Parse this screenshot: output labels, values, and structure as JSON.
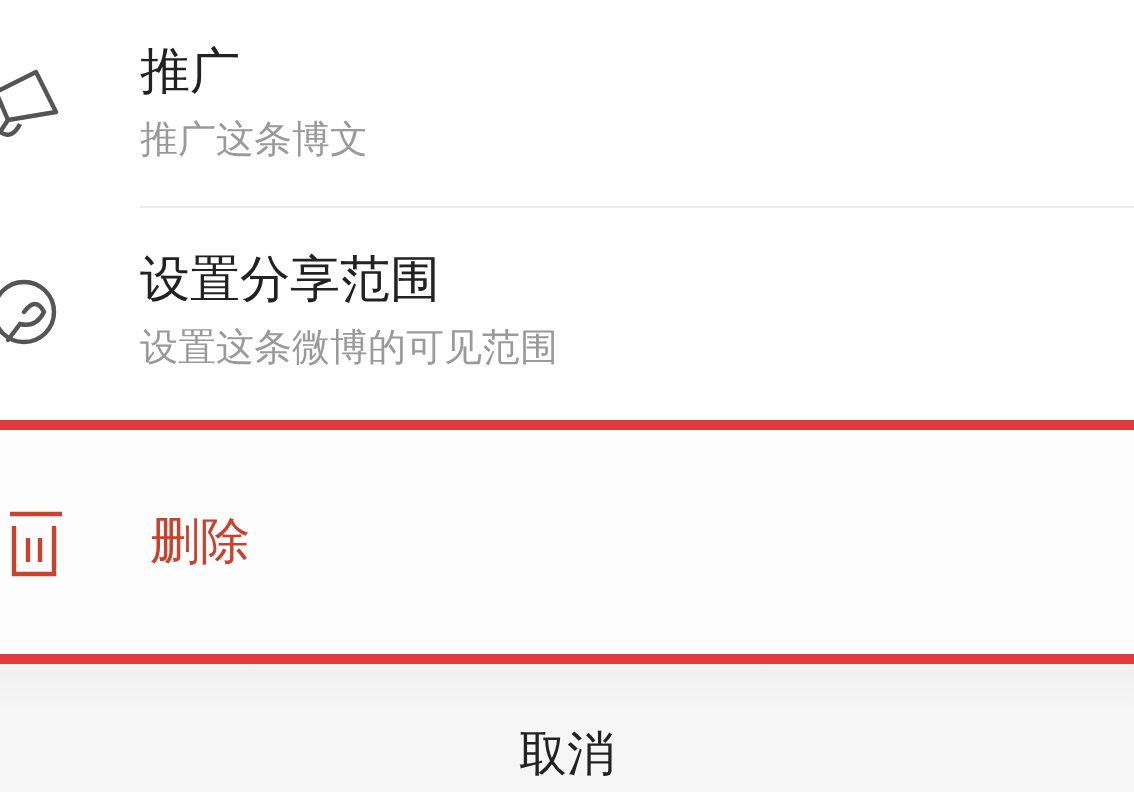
{
  "menu": {
    "items": [
      {
        "kind": "promote",
        "title": "推广",
        "subtitle": "推广这条博文",
        "highlighted": false
      },
      {
        "kind": "share-scope",
        "title": "设置分享范围",
        "subtitle": "设置这条微博的可见范围",
        "highlighted": false
      },
      {
        "kind": "delete",
        "title": "删除",
        "highlighted": true
      }
    ]
  },
  "cancel_button": {
    "label": "取消"
  }
}
